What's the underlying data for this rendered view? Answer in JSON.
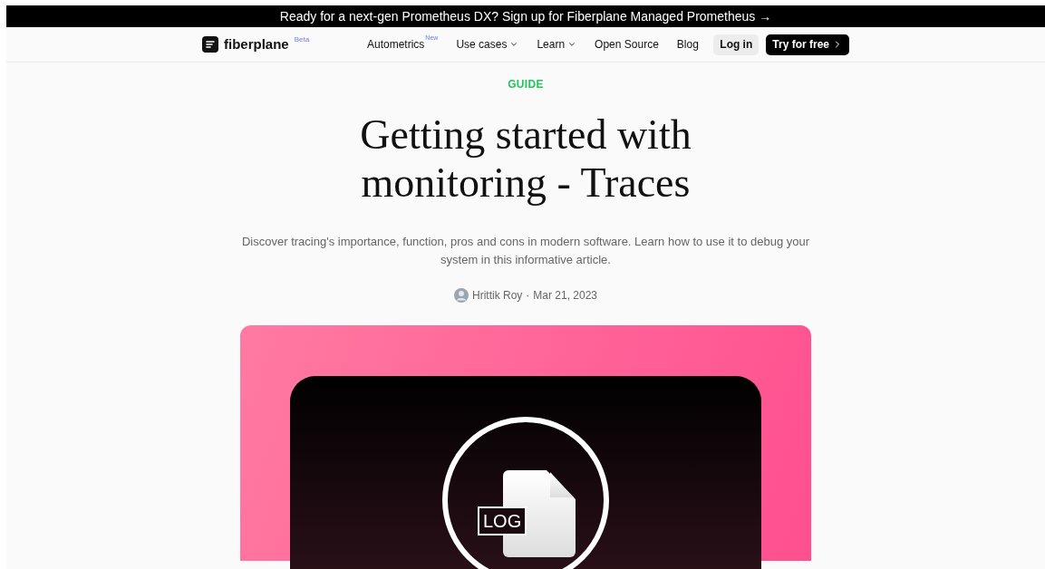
{
  "announcement": {
    "text": "Ready for a next-gen Prometheus DX? Sign up for Fiberplane Managed Prometheus →"
  },
  "header": {
    "logo": "fiberplane",
    "logo_badge": "Beta",
    "nav": [
      {
        "label": "Autometrics",
        "kind": "badge",
        "badge": "New"
      },
      {
        "label": "Use cases",
        "kind": "dropdown"
      },
      {
        "label": "Learn",
        "kind": "dropdown"
      },
      {
        "label": "Open Source",
        "kind": "link"
      },
      {
        "label": "Blog",
        "kind": "link"
      }
    ],
    "login": "Log in",
    "cta": "Try for free"
  },
  "article": {
    "category": "GUIDE",
    "title": "Getting started with monitoring - Traces",
    "summary": "Discover tracing's importance, function, pros and cons in modern software. Learn how to use it to debug your system in this informative article.",
    "author": "Hrittik Roy",
    "separator": "·",
    "date": "Mar 21, 2023",
    "hero": {
      "file_label": "LOG"
    }
  }
}
